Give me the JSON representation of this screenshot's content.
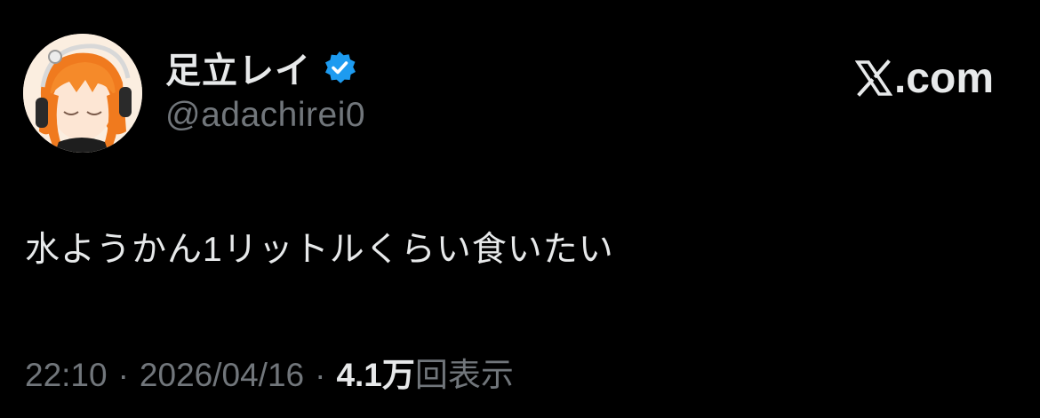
{
  "tweet": {
    "author": {
      "display_name": "足立レイ",
      "handle": "@adachirei0",
      "verified": true,
      "avatar_icon": "avatar-icon"
    },
    "site": {
      "label": ".com",
      "logo_icon": "x-logo-icon"
    },
    "text": "水ようかん1リットルくらい食いたい",
    "meta": {
      "time": "22:10",
      "separator": "·",
      "date": "2026/04/16",
      "views_count": "4.1万",
      "views_label": "回表示"
    }
  },
  "colors": {
    "background": "#000000",
    "primary_text": "#e7e9ea",
    "secondary_text": "#71767b",
    "verified_blue": "#1d9bf0",
    "avatar_hair": "#f07a1e"
  }
}
